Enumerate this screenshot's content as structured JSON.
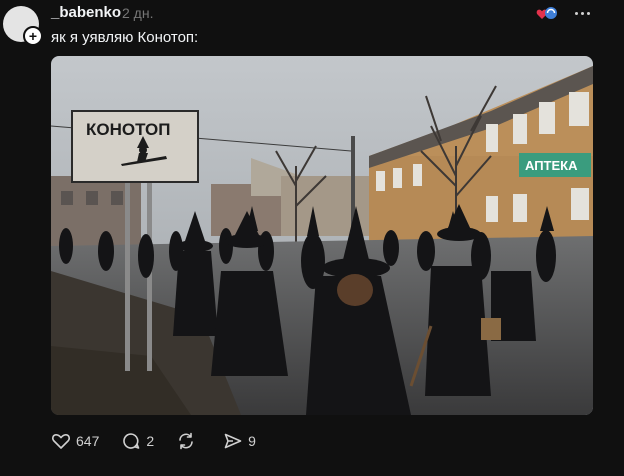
{
  "post": {
    "username": "_babenko",
    "timestamp": "2 дн.",
    "caption": "як я уявляю Конотоп:",
    "image": {
      "sign_text": "КОНОТОП",
      "shop_sign_text": "АПТЕКА"
    }
  },
  "actions": {
    "likes": "647",
    "replies": "2",
    "reposts": "",
    "shares": "9"
  },
  "colors": {
    "background": "#101010",
    "text_primary": "#f3f5f7",
    "text_secondary": "#777777",
    "badge_heart": "#e3324c"
  },
  "icons": [
    "follow-plus-icon",
    "heart-badge-icon",
    "more-icon",
    "heart-icon",
    "comment-icon",
    "repost-icon",
    "share-icon"
  ]
}
